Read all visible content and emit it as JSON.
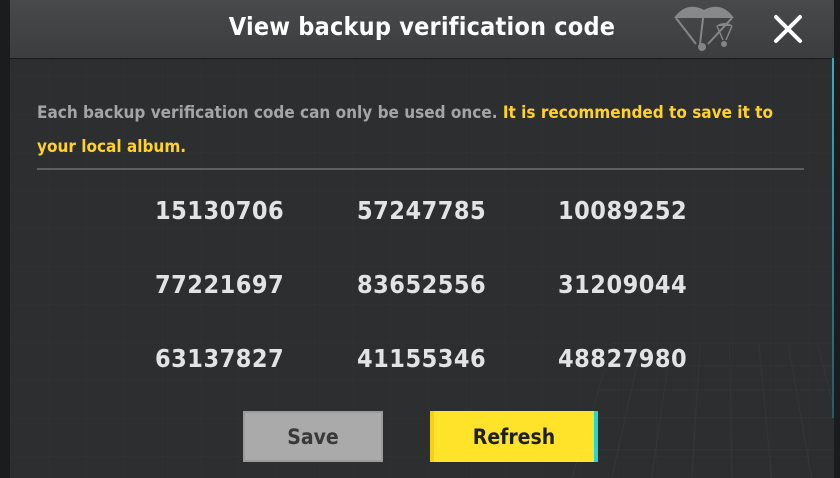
{
  "dialog": {
    "title": "View backup verification code",
    "close_icon": "close-icon",
    "notice": {
      "normal": "Each backup verification code can only be used once.",
      "highlight": "It is recommended to save it to your local album."
    },
    "codes": [
      "15130706",
      "57247785",
      "10089252",
      "77221697",
      "83652556",
      "31209044",
      "63137827",
      "41155346",
      "48827980"
    ],
    "buttons": {
      "save": "Save",
      "refresh": "Refresh"
    }
  },
  "colors": {
    "accent": "#ffd22a",
    "refresh_button": "#ffe32b",
    "save_button": "#aaaaaa",
    "panel": "#2d2e30"
  }
}
